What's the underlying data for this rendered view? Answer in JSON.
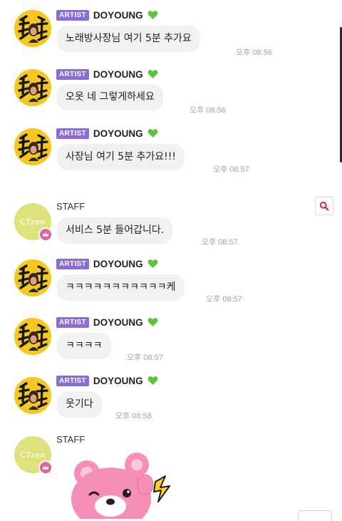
{
  "messages": [
    {
      "sender": "DOYOUNG",
      "badge": "ARTIST",
      "text": "노래방사장님 여기 5분 추가요",
      "time": "오후 08:56"
    },
    {
      "sender": "DOYOUNG",
      "badge": "ARTIST",
      "text": "오옷 네 그렇게하세요",
      "time": "오후 08:56"
    },
    {
      "sender": "DOYOUNG",
      "badge": "ARTIST",
      "text": "사장님 여기 5분 추가요!!!",
      "time": "오후 08:57"
    },
    {
      "sender": "STAFF",
      "text": "서비스 5분 들어갑니다.",
      "time": "오후 08:57"
    },
    {
      "sender": "DOYOUNG",
      "badge": "ARTIST",
      "text": "ㅋㅋㅋㅋㅋㅋㅋㅋㅋㅋㅋ케",
      "time": "오후 08:57"
    },
    {
      "sender": "DOYOUNG",
      "badge": "ARTIST",
      "text": "ㅋㅋㅋㅋ",
      "time": "오후 08:57"
    },
    {
      "sender": "DOYOUNG",
      "badge": "ARTIST",
      "text": "웃기다",
      "time": "오후 08:58"
    },
    {
      "sender": "STAFF",
      "sticker": "pink-bear-sticker"
    }
  ],
  "staff_avatar_text": "CTzen",
  "icons": {
    "heart": "green-heart-icon",
    "search": "search-icon",
    "crown": "crown-icon"
  },
  "colors": {
    "artist_badge": "#8a6bd8",
    "bubble": "#f1f1f3",
    "heart": "#5ec33a",
    "staff_avatar": "#dfe27c",
    "crown_badge": "#e0639c",
    "search_icon": "#d8262a"
  }
}
